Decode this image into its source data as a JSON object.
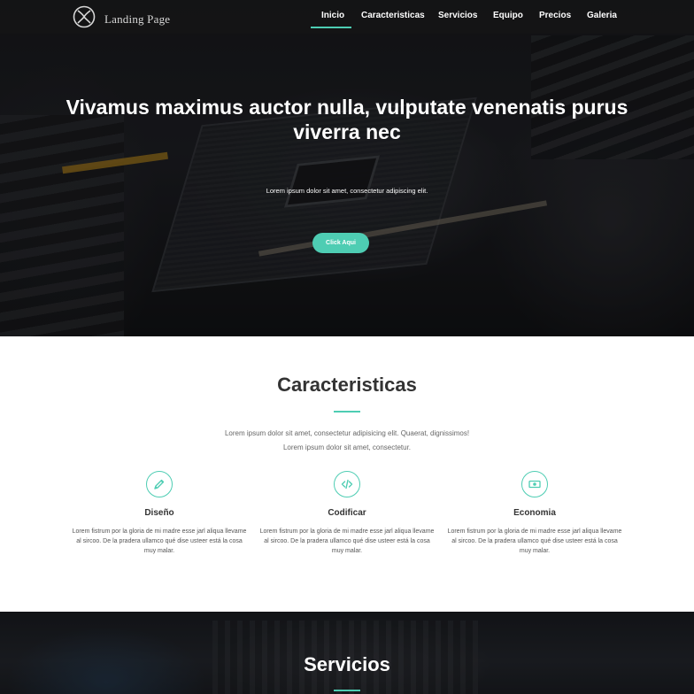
{
  "brand": {
    "name": "Landing Page",
    "logo": "xbox-like-logo"
  },
  "nav": {
    "items": [
      {
        "label": "Inicio",
        "active": true
      },
      {
        "label": "Caracteristicas",
        "active": false
      },
      {
        "label": "Servicios",
        "active": false
      },
      {
        "label": "Equipo",
        "active": false
      },
      {
        "label": "Precios",
        "active": false
      },
      {
        "label": "Galeria",
        "active": false
      }
    ]
  },
  "hero": {
    "title": "Vivamus maximus auctor nulla, vulputate venenatis purus viverra nec",
    "subtitle": "Lorem ipsum dolor sit amet, consectetur adipiscing elit.",
    "button": "Click Aqui"
  },
  "features": {
    "title": "Caracteristicas",
    "desc1": "Lorem ipsum dolor sit amet, consectetur adipisicing elit. Quaerat, dignissimos!",
    "desc2": "Lorem ipsum dolor sit amet, consectetur.",
    "items": [
      {
        "icon": "pencil-icon",
        "title": "Diseño",
        "text": "Lorem fistrum por la gloria de mi madre esse jarl aliqua llevame al sircoo. De la pradera ullamco qué dise usteer está la cosa muy malar."
      },
      {
        "icon": "code-icon",
        "title": "Codificar",
        "text": "Lorem fistrum por la gloria de mi madre esse jarl aliqua llevame al sircoo. De la pradera ullamco qué dise usteer está la cosa muy malar."
      },
      {
        "icon": "money-icon",
        "title": "Economia",
        "text": "Lorem fistrum por la gloria de mi madre esse jarl aliqua llevame al sircoo. De la pradera ullamco qué dise usteer está la cosa muy malar."
      }
    ]
  },
  "services": {
    "title": "Servicios"
  },
  "colors": {
    "accent": "#4ecdb3",
    "heading": "#333333",
    "nav_bg": "#141416"
  }
}
